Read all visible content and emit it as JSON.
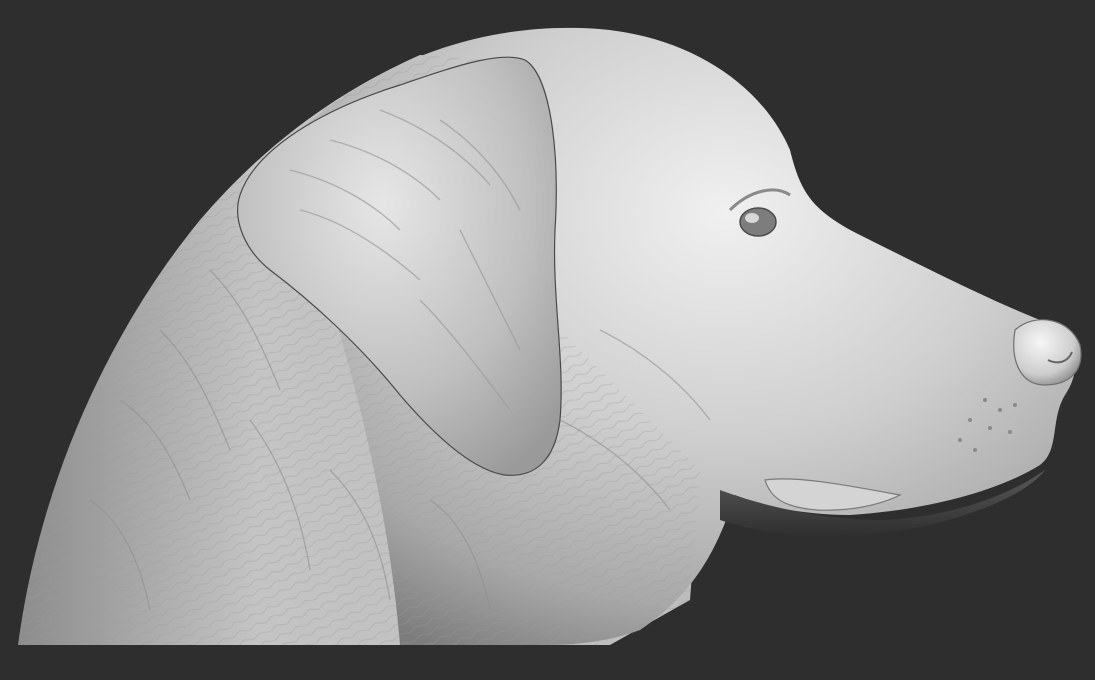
{
  "scene": {
    "subject": "dog-head-sculpt",
    "background_color": "#2e2e2e",
    "material_colors": {
      "highlight": "#f2f2f2",
      "base": "#c9c9c9",
      "mid": "#a9a9a9",
      "shadow": "#6a6a6a",
      "deep_shadow": "#3a3a3a"
    }
  }
}
